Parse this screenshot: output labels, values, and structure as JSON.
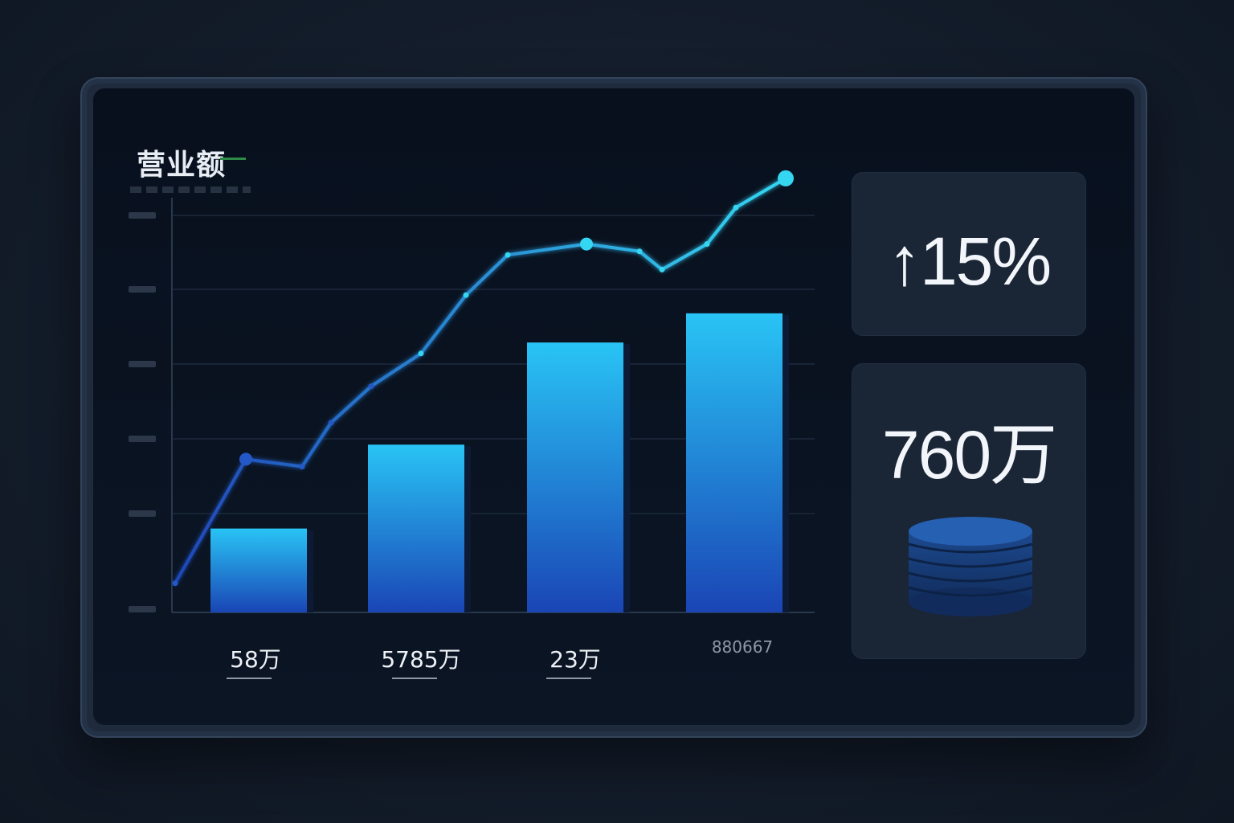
{
  "chart_data": {
    "type": "bar",
    "title": "营业额",
    "categories": [
      "58万",
      "5785万",
      "23万",
      "880667"
    ],
    "values": [
      23,
      46,
      74,
      82
    ],
    "line_series": {
      "values": [
        8,
        42,
        40,
        52,
        62,
        71,
        87,
        98,
        101,
        99,
        94,
        101,
        111,
        119
      ]
    },
    "ylim": [
      0,
      130
    ],
    "grid": true
  },
  "kpis": {
    "growth": "↑15%",
    "total": "760万"
  },
  "colors": {
    "bar_top": "#29c4f5",
    "bar_bottom": "#1a45b5",
    "line_start": "#1f47b8",
    "line_end": "#34d6f2",
    "grid": "#1d2a3c"
  },
  "icons": {
    "coin_stack": "coin-stack-icon"
  }
}
